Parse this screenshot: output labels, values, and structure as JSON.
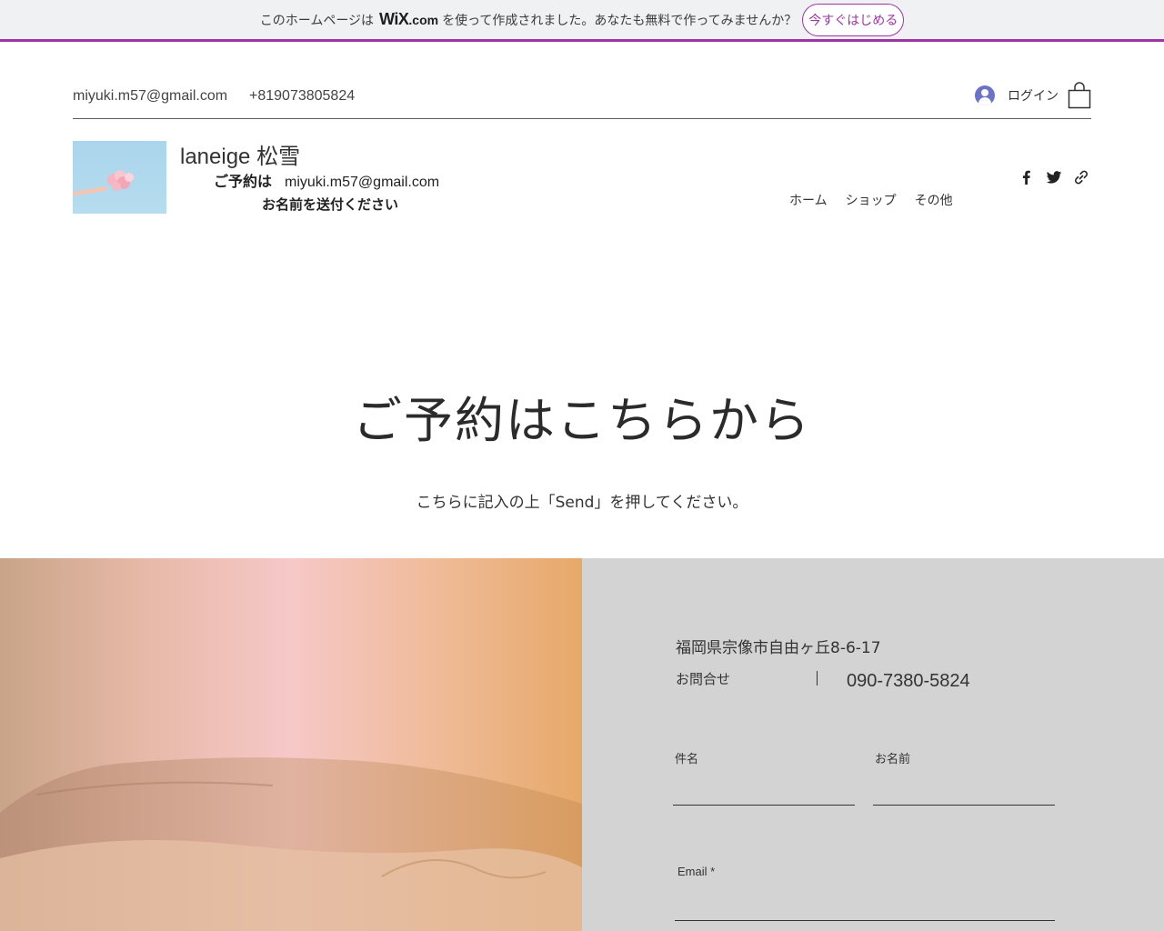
{
  "wix_banner": {
    "pre_text": "このホームページは",
    "logo": "WiX",
    "logo_suffix": ".com",
    "post_text": "を使って作成されました。あなたも無料で作ってみませんか？",
    "cta_label": "今すぐはじめる"
  },
  "topbar": {
    "email": "miyuki.m57@gmail.com",
    "phone": "+819073805824",
    "login_label": "ログイン"
  },
  "header": {
    "site_title": "laneige 松雪",
    "tagline_prefix": "ご予約は",
    "tagline_email": "miyuki.m57@gmail.com",
    "tagline_line2": "お名前を送付ください"
  },
  "nav": {
    "items": [
      "ホーム",
      "ショップ",
      "その他"
    ]
  },
  "social": {
    "icons": [
      "facebook-icon",
      "twitter-icon",
      "link-icon"
    ]
  },
  "hero": {
    "title": "ご予約はこちらから",
    "subtitle": "こちらに記入の上「Send」を押してください。"
  },
  "contact": {
    "address": "福岡県宗像市自由ヶ丘8-6-17",
    "inquiry_label": "お問合せ",
    "phone": "090-7380-5824"
  },
  "form": {
    "subject_label": "件名",
    "name_label": "お名前",
    "email_label": "Email *"
  },
  "colors": {
    "wix_accent": "#a034a6",
    "panel_bg": "#d3d3d3",
    "banner_bg": "#eff1f2"
  }
}
